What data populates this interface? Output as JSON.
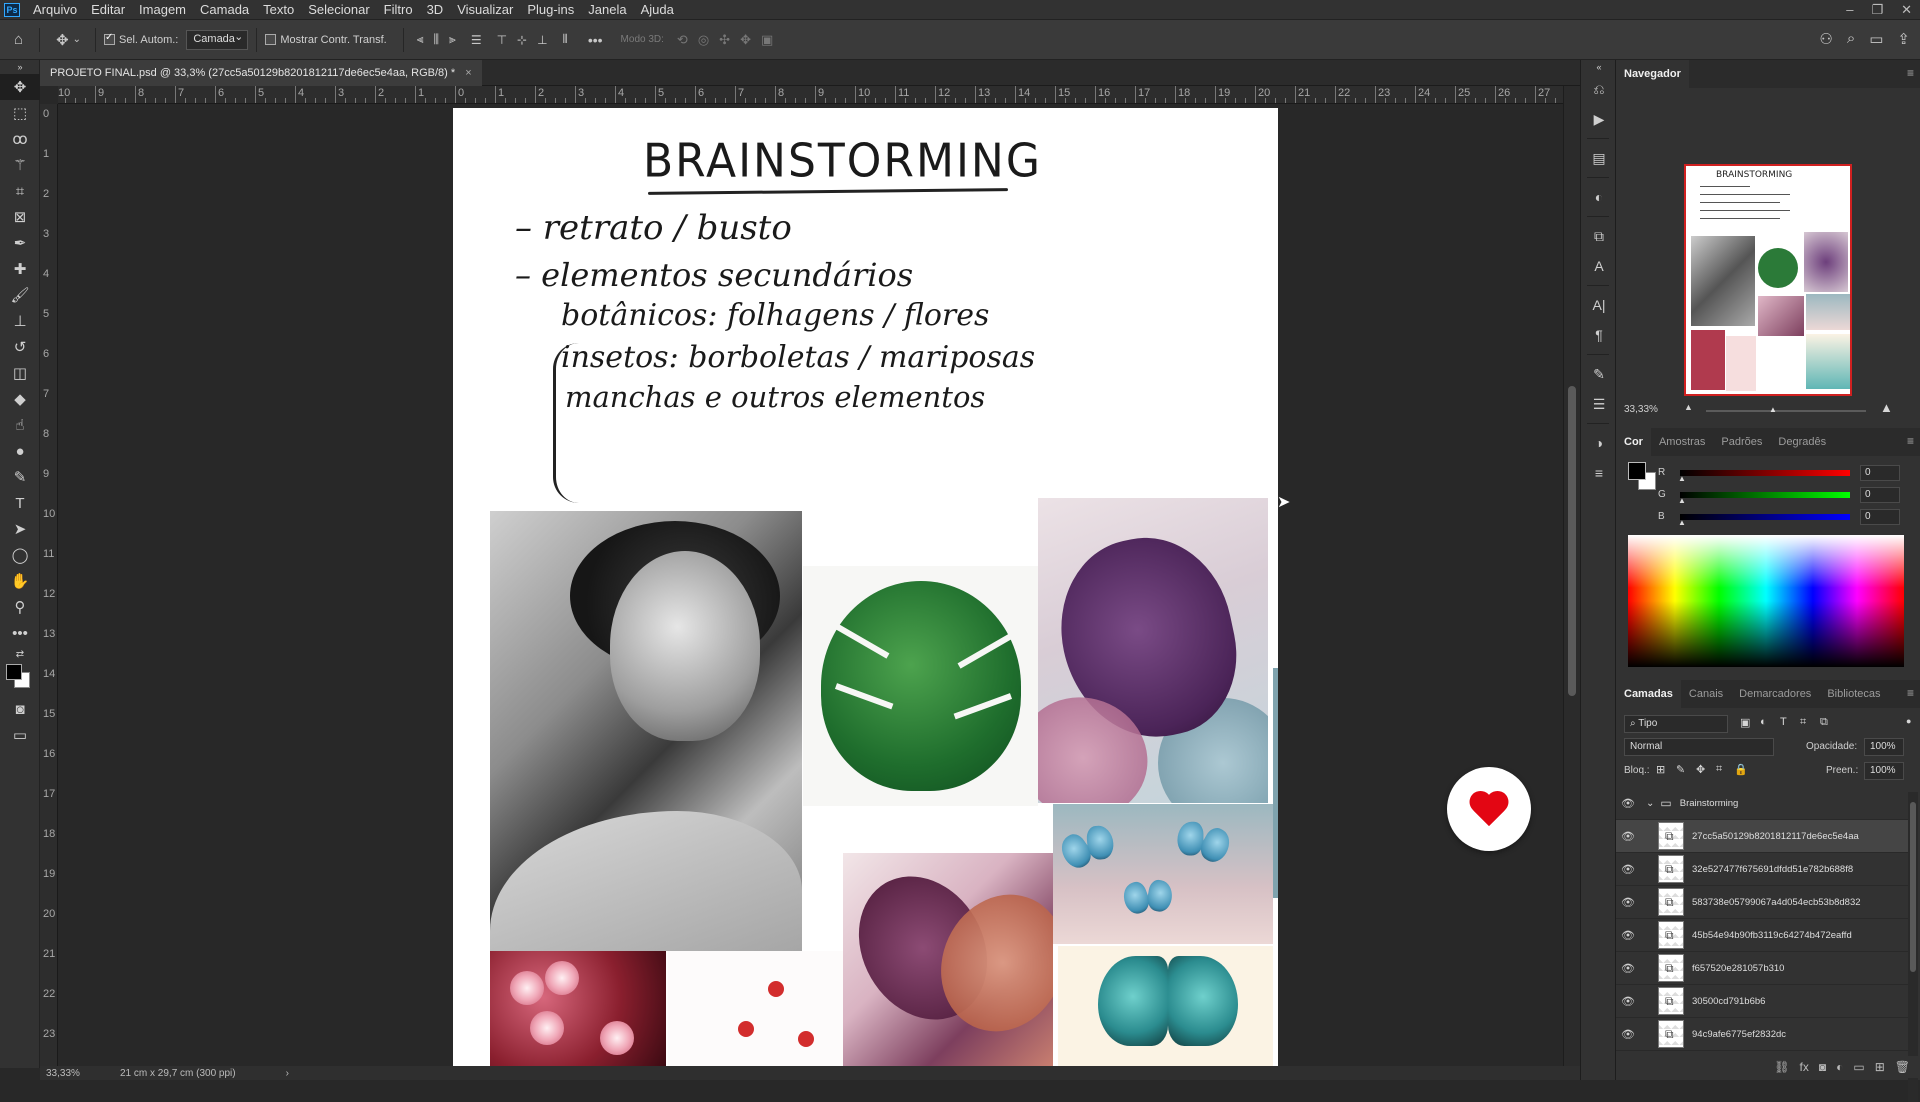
{
  "menubar": {
    "items": [
      "Arquivo",
      "Editar",
      "Imagem",
      "Camada",
      "Texto",
      "Selecionar",
      "Filtro",
      "3D",
      "Visualizar",
      "Plug-ins",
      "Janela",
      "Ajuda"
    ],
    "logo": "Ps"
  },
  "options": {
    "auto_select_label": "Sel. Autom.:",
    "auto_select_value": "Camada",
    "transform_label": "Mostrar Contr. Transf.",
    "mode3d_label": "Modo 3D:"
  },
  "document": {
    "tab_title": "PROJETO FINAL.psd @ 33,3% (27cc5a50129b8201812117de6ec5e4aa, RGB/8) *",
    "title": "BRAINSTORMING",
    "lines": [
      "– retrato / busto",
      "– elementos secundários",
      "botânicos: folhagens / flores",
      "insetos: borboletas / mariposas",
      "manchas e outros elementos"
    ]
  },
  "rulers": {
    "top": [
      "10",
      "9",
      "8",
      "7",
      "6",
      "5",
      "4",
      "3",
      "2",
      "1",
      "0",
      "1",
      "2",
      "3",
      "4",
      "5",
      "6",
      "7",
      "8",
      "9",
      "10",
      "11",
      "12",
      "13",
      "14",
      "15",
      "16",
      "17",
      "18",
      "19",
      "20",
      "21",
      "22",
      "23",
      "24",
      "25",
      "26",
      "27"
    ],
    "left": [
      "0",
      "1",
      "2",
      "3",
      "4",
      "5",
      "6",
      "7",
      "8",
      "9",
      "10",
      "11",
      "12",
      "13",
      "14",
      "15",
      "16",
      "17",
      "18",
      "19",
      "20",
      "21",
      "22",
      "23"
    ]
  },
  "statusbar": {
    "zoom": "33,33%",
    "doc_info": "21 cm x 29,7 cm (300 ppi)"
  },
  "navigator": {
    "tab": "Navegador",
    "zoom": "33,33%",
    "thumb_title": "BRAINSTORMING"
  },
  "color": {
    "tabs": [
      "Cor",
      "Amostras",
      "Padrões",
      "Degradês"
    ],
    "channels": [
      {
        "label": "R",
        "value": "0"
      },
      {
        "label": "G",
        "value": "0"
      },
      {
        "label": "B",
        "value": "0"
      }
    ]
  },
  "layers": {
    "tabs": [
      "Camadas",
      "Canais",
      "Demarcadores",
      "Bibliotecas"
    ],
    "filter": "Tipo",
    "blend_mode": "Normal",
    "opacity_label": "Opacidade:",
    "opacity": "100%",
    "lock_label": "Bloq.:",
    "fill_label": "Preen.:",
    "fill": "100%",
    "group": "Brainstorming",
    "items": [
      "27cc5a50129b8201812117de6ec5e4aa",
      "32e527477f675691dfdd51e782b688f8",
      "583738e05799067a4d054ecb53b8d832",
      "45b54e94b90fb3119c64274b472eaffd",
      "f657520e281057b310",
      "30500cd791b6b6",
      "94c9afe6775ef2832dc"
    ]
  },
  "colors": {
    "accent": "#31a8ff",
    "badge": "#e30613"
  }
}
